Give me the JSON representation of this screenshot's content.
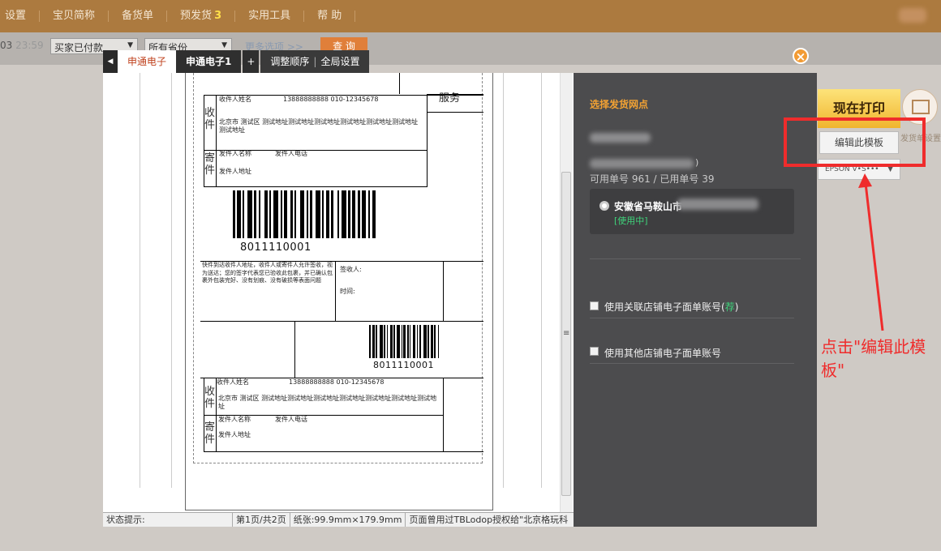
{
  "topnav": {
    "items": [
      "设置",
      "宝贝简称",
      "备货单",
      "预发货",
      "实用工具",
      "帮 助"
    ],
    "presell_badge": "3"
  },
  "filter": {
    "date_partial": "03",
    "time_partial": "23:59",
    "status_select": "买家已付款",
    "province_select": "所有省份",
    "more_options": "更多选项 >>",
    "query_button": "查 询"
  },
  "tabs": {
    "items": [
      "申通电子",
      "申通电子1"
    ],
    "add": "+",
    "reorder": "调整顺序",
    "global": "全局设置"
  },
  "close_icon": "close-icon",
  "label": {
    "header_fragment": "",
    "service": "服务",
    "recv_label": "收件",
    "send_label": "寄件",
    "recv_name": "收件人姓名",
    "recv_phone": "13888888888 010-12345678",
    "recv_addr": "北京市 测试区 测试地址测试地址测试地址测试地址测试地址测试地址测试地址",
    "recv_addr2": "北京市 测试区 测试地址测试地址测试地址测试地址测试地址测试地址测试地址",
    "send_name": "发件人名称",
    "send_phone": "发件人电话",
    "send_addr": "发件人地址",
    "barcode_number": "8011110001",
    "barcode_number_small": "8011110001",
    "disclaimer": "快件到达收件人地址，收件人或寄件人允许签收，视为送达；您的签字代表您已验收此包裹，并已确认包裹外包装完好、没有划痕、没有破损等表面问题",
    "signer": "签收人:",
    "sign_time": "时间:"
  },
  "statusbar": {
    "status": "状态提示:",
    "page": "第1页/共2页",
    "paper": "纸张:99.9mm×179.9mm",
    "license": "页面曾用过TBLodop授权给\"北京格玩科"
  },
  "panel": {
    "title": "选择发货网点",
    "paren": ")",
    "quota": "可用单号 961 / 已用单号 39",
    "branch_addr": "安徽省马鞍山市",
    "branch_status": "[使用中]",
    "option1": "使用关联店铺电子面单账号",
    "option1_extra": "荐",
    "option2": "使用其他店铺电子面单账号"
  },
  "actions": {
    "print_now": "现在打印",
    "edit_template": "编辑此模板",
    "printer": "EPSON V•S•••",
    "side_caption": "发货单设置"
  },
  "annotation": {
    "text": "点击\"编辑此模板\"",
    "color": "#ef2c2c"
  }
}
